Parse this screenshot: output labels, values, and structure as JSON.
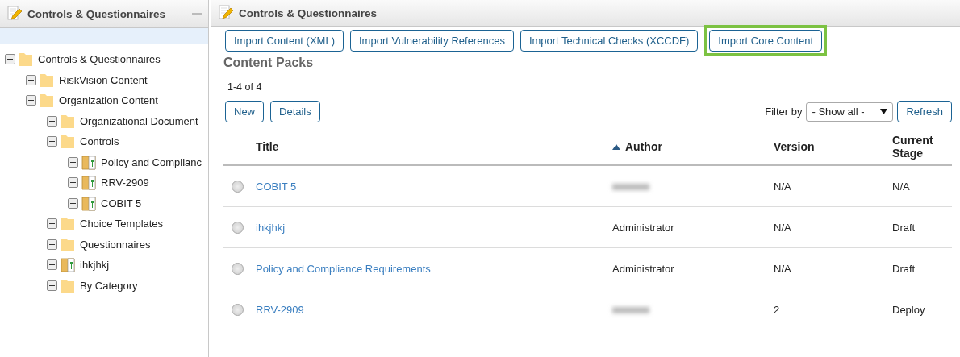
{
  "sidebar": {
    "title": "Controls & Questionnaires",
    "tree": [
      {
        "label": "Controls & Questionnaires",
        "kind": "folder",
        "expanded": true,
        "children": [
          {
            "label": "RiskVision Content",
            "kind": "folder",
            "expanded": false
          },
          {
            "label": "Organization Content",
            "kind": "folder",
            "expanded": true,
            "children": [
              {
                "label": "Organizational Document",
                "kind": "folder",
                "expanded": false
              },
              {
                "label": "Controls",
                "kind": "folder",
                "expanded": true,
                "children": [
                  {
                    "label": "Policy and Complianc",
                    "kind": "pack",
                    "expanded": false
                  },
                  {
                    "label": "RRV-2909",
                    "kind": "pack",
                    "expanded": false
                  },
                  {
                    "label": "COBIT 5",
                    "kind": "pack",
                    "expanded": false
                  }
                ]
              },
              {
                "label": "Choice Templates",
                "kind": "folder",
                "expanded": false
              },
              {
                "label": "Questionnaires",
                "kind": "folder",
                "expanded": false
              },
              {
                "label": "ihkjhkj",
                "kind": "pack",
                "expanded": false
              },
              {
                "label": "By Category",
                "kind": "folder",
                "expanded": false
              }
            ]
          }
        ]
      }
    ]
  },
  "main": {
    "title": "Controls & Questionnaires",
    "import_buttons": [
      {
        "label": "Import Content (XML)",
        "highlighted": false
      },
      {
        "label": "Import Vulnerability References",
        "highlighted": false
      },
      {
        "label": "Import Technical Checks (XCCDF)",
        "highlighted": false
      },
      {
        "label": "Import Core Content",
        "highlighted": true
      }
    ],
    "section_title": "Content Packs",
    "count": "1-4 of 4",
    "actions": [
      "New",
      "Details"
    ],
    "filter": {
      "label": "Filter by",
      "value": "- Show all -",
      "refresh": "Refresh"
    },
    "table": {
      "columns": [
        {
          "label": "Title",
          "sorted": false
        },
        {
          "label": "Author",
          "sorted": true
        },
        {
          "label": "Version",
          "sorted": false
        },
        {
          "label": "Current Stage",
          "sorted": false
        }
      ],
      "rows": [
        {
          "selected": false,
          "title": "COBIT 5",
          "author_blurred": true,
          "version": "N/A",
          "stage": "N/A"
        },
        {
          "selected": false,
          "title": "ihkjhkj",
          "author": "Administrator",
          "version": "N/A",
          "stage": "Draft"
        },
        {
          "selected": false,
          "title": "Policy and Compliance Requirements",
          "author": "Administrator",
          "version": "N/A",
          "stage": "Draft"
        },
        {
          "selected": false,
          "title": "RRV-2909",
          "author_blurred": true,
          "version": "2",
          "stage": "Deploy"
        }
      ]
    }
  }
}
